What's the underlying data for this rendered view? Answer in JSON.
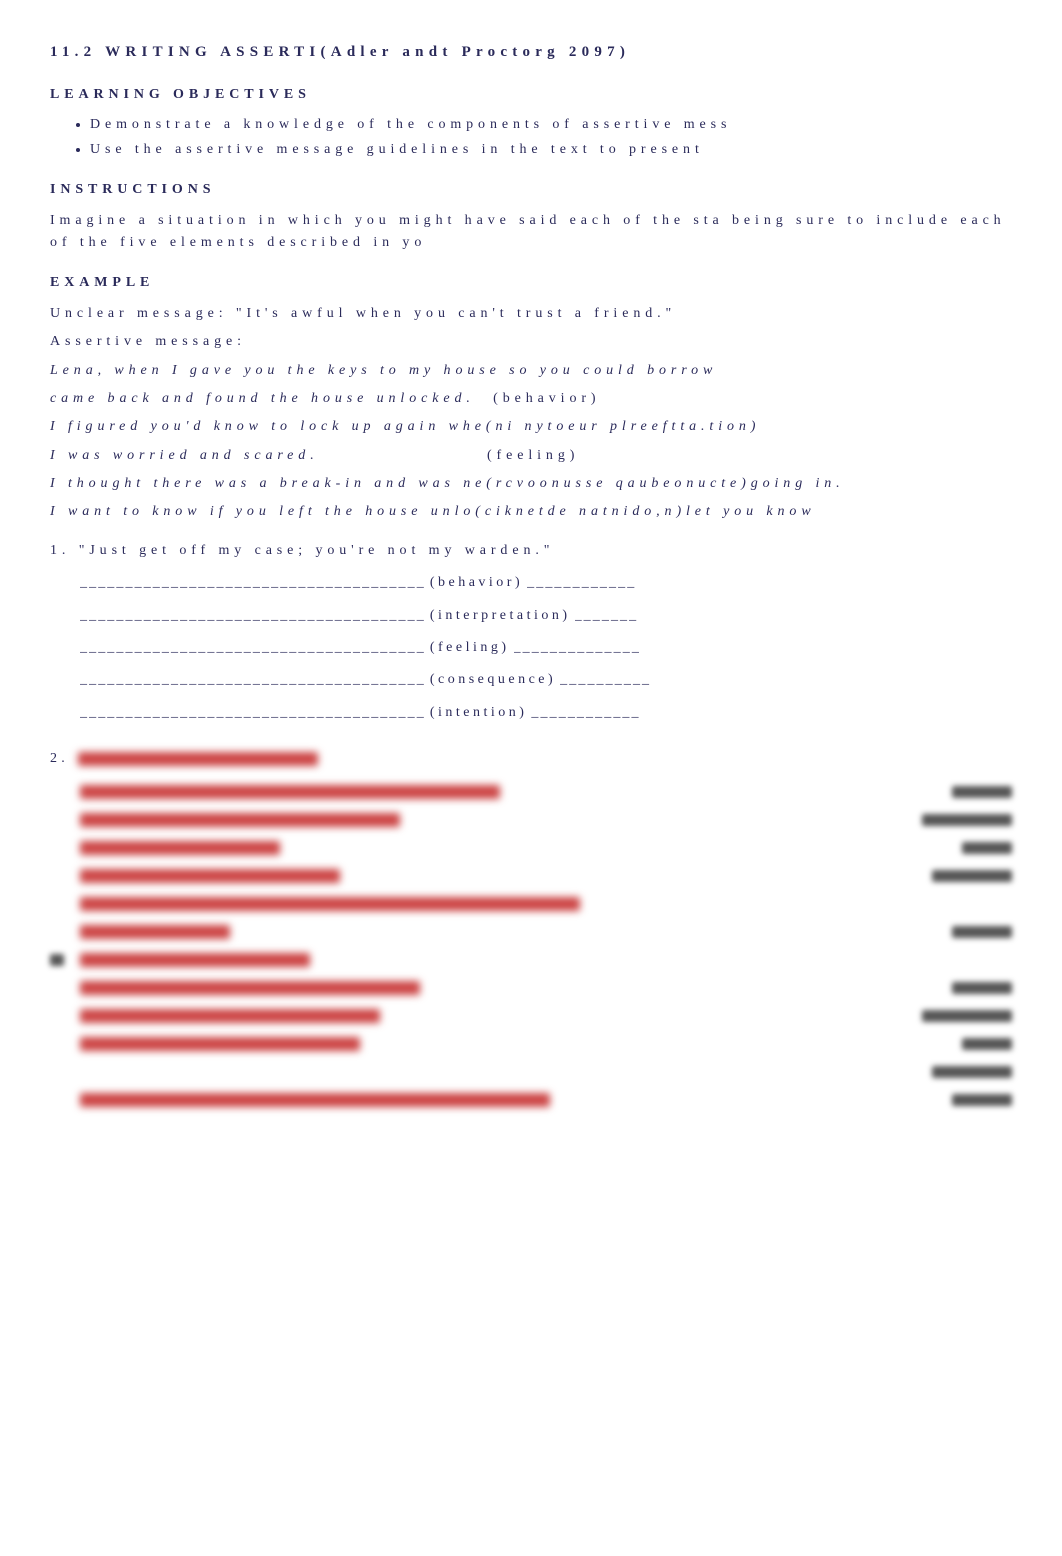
{
  "title": "11.2 WRITING ASSERTI(Adler andt Proctorg 2097)",
  "headings": {
    "objectives": "LEARNING OBJECTIVES",
    "instructions": "INSTRUCTIONS",
    "example": "EXAMPLE"
  },
  "objectives": [
    "Demonstrate a knowledge of the components of assertive mess",
    "Use the assertive message guidelines in the text to present"
  ],
  "instructions": "Imagine a situation in which you might have said each of the sta being sure to include each of the five elements described in yo",
  "example": {
    "unclear_label": "Unclear message: ",
    "unclear_text": "\"It's awful when you can't trust a friend.\"",
    "assertive_label": "Assertive message:",
    "line1": "Lena, when I gave you the keys to my house so you could borrow ",
    "line2a": "came back and found the house unlocked.",
    "line2b": "(behavior)",
    "line3a": "I figured you'd know to lock up again whe(ni nytoeur plreeftta.tion)",
    "line4a": "I was worried and scared.",
    "line4b": "(feeling)",
    "line5a": "I thought there was a break-in and was ne(rcvoonusse qaubeonucte)going in.",
    "line6a": "I want to know if you left the house unlo(ciknetde natnido,n)let you know"
  },
  "q1": {
    "num": "1.",
    "text": "\"Just get off my case; you're not my warden.\"",
    "labels": {
      "behavior": "(behavior)",
      "interpretation": "(interpretation)",
      "feeling": "(feeling)",
      "consequence": "(consequence)",
      "intention": "(intention)"
    }
  },
  "q2": {
    "num": "2."
  },
  "dash38": "______________________________________"
}
